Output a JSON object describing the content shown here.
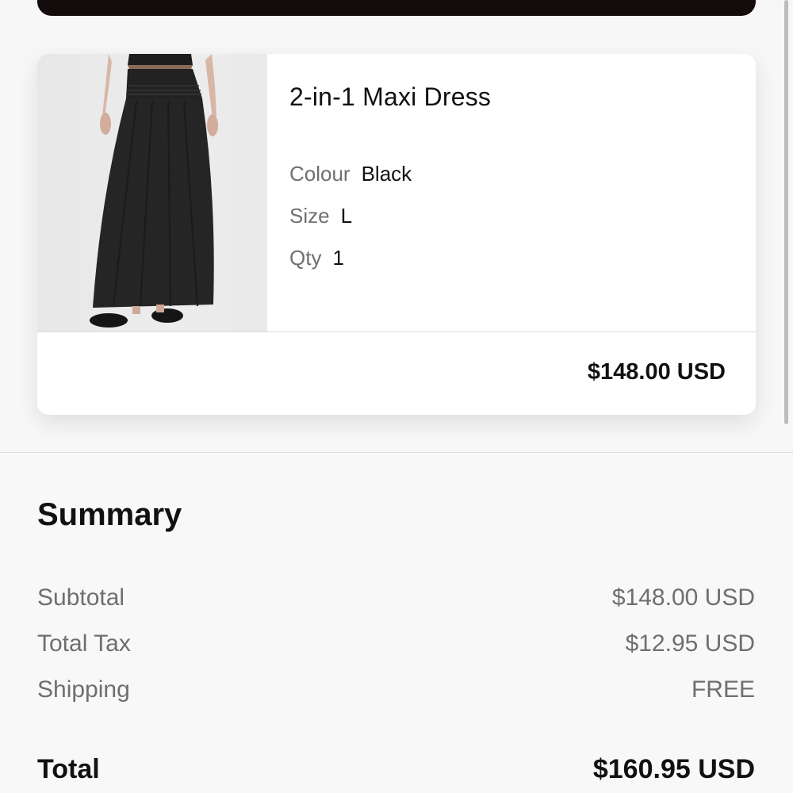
{
  "product": {
    "name": "2-in-1 Maxi Dress",
    "colour_label": "Colour",
    "colour_value": "Black",
    "size_label": "Size",
    "size_value": "L",
    "qty_label": "Qty",
    "qty_value": "1",
    "price": "$148.00 USD"
  },
  "summary": {
    "title": "Summary",
    "rows": [
      {
        "label": "Subtotal",
        "value": "$148.00 USD"
      },
      {
        "label": "Total Tax",
        "value": "$12.95 USD"
      },
      {
        "label": "Shipping",
        "value": "FREE"
      }
    ],
    "total_label": "Total",
    "total_value": "$160.95 USD"
  },
  "colors": {
    "top_button": "#140c0c",
    "muted_text": "#6f6f6f",
    "text": "#111111"
  }
}
